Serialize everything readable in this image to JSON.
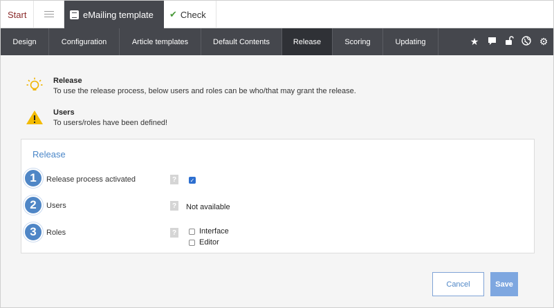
{
  "top_tabs": {
    "start": "Start",
    "list_icon": "list-icon",
    "email": "eMailing template",
    "email_icon": "document-icon",
    "check": "Check",
    "check_icon": "checkmark-icon"
  },
  "nav": {
    "items": [
      "Design",
      "Configuration",
      "Article templates",
      "Default Contents",
      "Release",
      "Scoring",
      "Updating"
    ],
    "active": "Release",
    "icons": [
      "star-icon",
      "comment-icon",
      "unlock-icon",
      "globe-icon",
      "gear-icon"
    ]
  },
  "info": [
    {
      "icon": "lightbulb-icon",
      "title": "Release",
      "text": "To use the release process, below users and roles can be who/that may grant the release."
    },
    {
      "icon": "warning-icon",
      "title": "Users",
      "text": "To users/roles have been defined!"
    }
  ],
  "panel": {
    "title": "Release",
    "rows": [
      {
        "number": "1",
        "label": "Release process activated",
        "help": "?",
        "checked": true
      },
      {
        "number": "2",
        "label": "Users",
        "help": "?",
        "value": "Not available"
      },
      {
        "number": "3",
        "label": "Roles",
        "help": "?",
        "options": [
          "Interface",
          "Editor"
        ]
      }
    ]
  },
  "buttons": {
    "cancel": "Cancel",
    "save": "Save"
  },
  "colors": {
    "nav_bg": "#45474d",
    "accent_blue": "#4f86c6",
    "save_bg": "#7ea7e0",
    "start_text": "#8a2a2a"
  }
}
